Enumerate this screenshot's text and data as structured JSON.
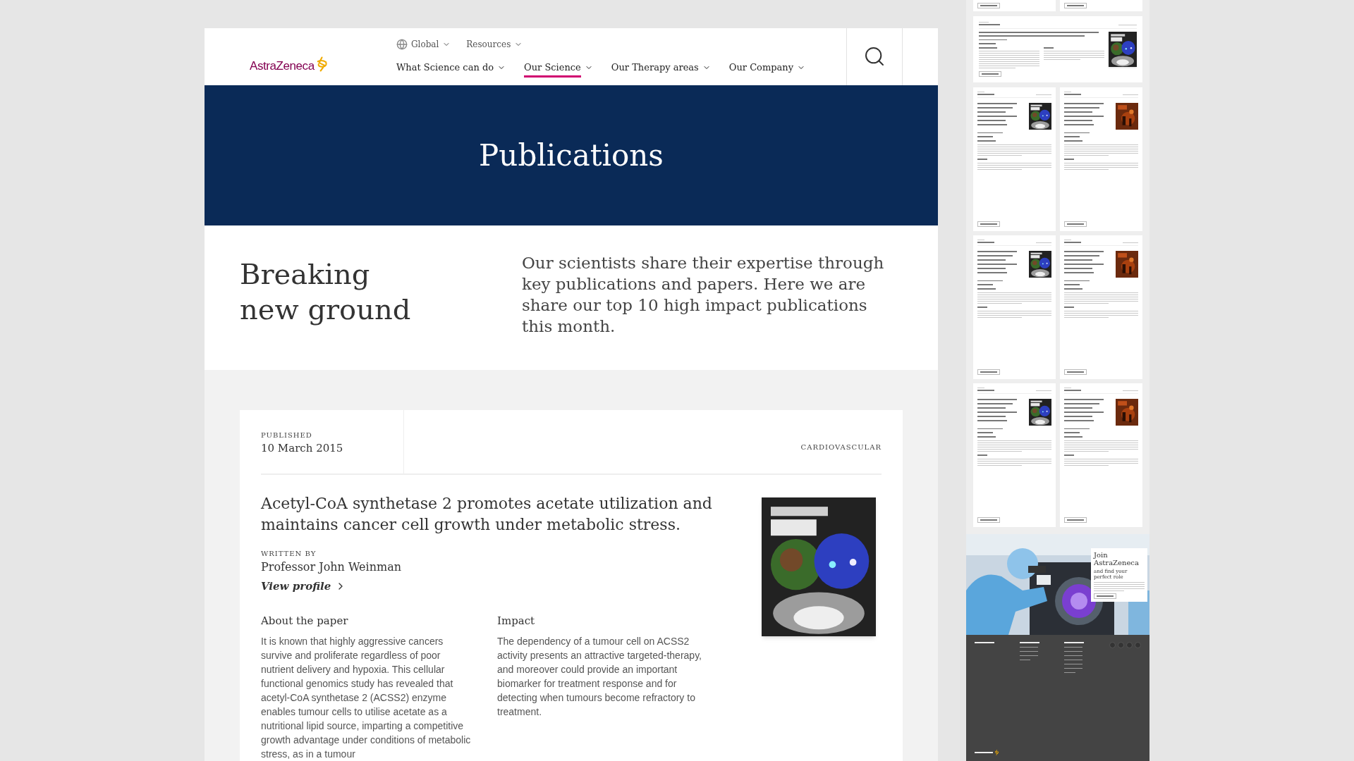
{
  "header": {
    "logo": "AstraZeneca",
    "utility": [
      {
        "label": "Global",
        "kind": "globe"
      },
      {
        "label": "Resources",
        "kind": "plain"
      }
    ],
    "nav": [
      {
        "label": "What Science can do",
        "selected": false
      },
      {
        "label": "Our Science",
        "selected": true
      },
      {
        "label": "Our Therapy areas",
        "selected": false
      },
      {
        "label": "Our Company",
        "selected": false
      }
    ]
  },
  "banner": {
    "title": "Publications"
  },
  "intro": {
    "heading": "Breaking new ground",
    "text": "Our scientists share their expertise through key publications and papers. Here we are share our top 10 high impact publications this month."
  },
  "publication": {
    "published_label": "PUBLISHED",
    "date": "10 March 2015",
    "area": "CARDIOVASCULAR",
    "title": "Acetyl-CoA synthetase 2 promotes acetate utilization and maintains cancer cell growth under metabolic stress.",
    "written_by_label": "WRITTEN BY",
    "author": "Professor John Weinman",
    "profile_link": "View profile",
    "sections": [
      {
        "heading": "About the paper",
        "text": "It is known that highly aggressive cancers survive and proliferate regardless of poor nutrient delivery and hypoxia. This cellular functional genomics study has revealed that acetyl-CoA synthetase 2 (ACSS2) enzyme enables tumour cells to utilise acetate as a nutritional lipid source, imparting a competitive growth advantage under conditions of metabolic stress, as in a tumour"
      },
      {
        "heading": "Impact",
        "text": "The dependency of a tumour cell on ACSS2 activity presents an attractive targeted-therapy, and moreover could provide an important biomarker for treatment response and for detecting when tumours become refractory to treatment."
      }
    ]
  },
  "preview": {
    "wide_card": {
      "kind": "cancer-cell"
    },
    "cards": [
      {
        "kind": "cancer-cell"
      },
      {
        "kind": "orange"
      },
      {
        "kind": "cancer-cell"
      },
      {
        "kind": "orange"
      },
      {
        "kind": "cancer-cell"
      },
      {
        "kind": "orange"
      }
    ],
    "join": {
      "title": "Join AstraZeneca",
      "subtitle": "and find your perfect role"
    }
  }
}
